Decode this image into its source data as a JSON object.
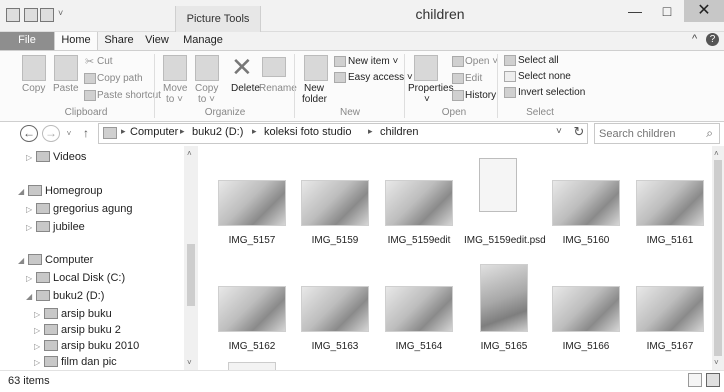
{
  "window": {
    "title": "children",
    "context_tab_group": "Picture Tools",
    "minimize_glyph": "—",
    "maximize_glyph": "□",
    "close_glyph": "✕"
  },
  "ribbon_tabs": {
    "file": "File",
    "home": "Home",
    "share": "Share",
    "view": "View",
    "manage": "Manage",
    "collapse_glyph": "^",
    "help_glyph": "?"
  },
  "ribbon": {
    "clipboard": {
      "copy": "Copy",
      "paste": "Paste",
      "cut": "Cut",
      "copy_path": "Copy path",
      "paste_shortcut": "Paste shortcut",
      "label": "Clipboard"
    },
    "organize": {
      "move_to": "Move",
      "move_to_2": "to ˅",
      "copy_to": "Copy",
      "copy_to_2": "to ˅",
      "delete": "Delete",
      "rename": "Rename",
      "label": "Organize"
    },
    "new": {
      "new_folder": "New",
      "new_folder_2": "folder",
      "new_item": "New item ˅",
      "easy_access": "Easy access ˅",
      "label": "New"
    },
    "open": {
      "properties": "Properties",
      "properties_2": "˅",
      "open": "Open ˅",
      "edit": "Edit",
      "history": "History",
      "label": "Open"
    },
    "select": {
      "select_all": "Select all",
      "select_none": "Select none",
      "invert_selection": "Invert selection",
      "label": "Select"
    }
  },
  "address": {
    "back_glyph": "←",
    "forward_glyph": "→",
    "recent_glyph": "˅",
    "up_glyph": "↑",
    "crumbs": [
      "Computer",
      "buku2 (D:)",
      "koleksi foto studio",
      "children"
    ],
    "crumb_sep": "▸",
    "dropdown_glyph": "˅",
    "refresh_glyph": "↻"
  },
  "search": {
    "placeholder": "Search children",
    "icon_glyph": "⌕"
  },
  "nav": {
    "items": [
      {
        "label": "Videos",
        "expander": "▷"
      },
      {
        "label": "Homegroup",
        "expander": "◢"
      },
      {
        "label": "gregorius agung",
        "expander": "▷"
      },
      {
        "label": "jubilee",
        "expander": "▷"
      },
      {
        "label": "Computer",
        "expander": "◢"
      },
      {
        "label": "Local Disk (C:)",
        "expander": "▷"
      },
      {
        "label": "buku2 (D:)",
        "expander": "◢"
      },
      {
        "label": "arsip buku",
        "expander": "▷"
      },
      {
        "label": "arsip buku 2",
        "expander": "▷"
      },
      {
        "label": "arsip buku 2010",
        "expander": "▷"
      },
      {
        "label": "film dan pic",
        "expander": "▷"
      }
    ],
    "scroll_up": "˄",
    "scroll_down": "˅"
  },
  "files": {
    "row1": [
      "IMG_5157",
      "IMG_5159",
      "IMG_5159edit",
      "IMG_5159edit.psd",
      "IMG_5160",
      "IMG_5161"
    ],
    "row2": [
      "IMG_5162",
      "IMG_5163",
      "IMG_5164",
      "IMG_5165",
      "IMG_5166",
      "IMG_5167"
    ]
  },
  "status": {
    "item_count": "63 items"
  }
}
